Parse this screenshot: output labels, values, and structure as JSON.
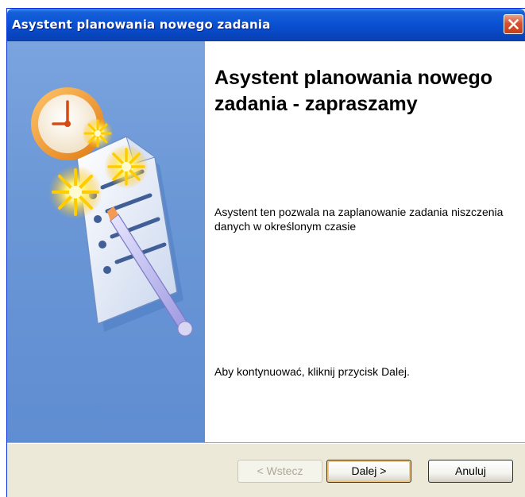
{
  "window": {
    "title": "Asystent planowania nowego zadania"
  },
  "content": {
    "heading": "Asystent planowania nowego zadania - zapraszamy",
    "description": "Asystent ten pozwala na zaplanowanie zadania niszczenia danych w określonym czasie",
    "hint": "Aby kontynuować, kliknij przycisk Dalej."
  },
  "buttons": {
    "back": "< Wstecz",
    "next": "Dalej >",
    "cancel": "Anuluj"
  },
  "icons": {
    "close": "close-icon",
    "wizard": "scheduled-task-wizard-icon"
  },
  "colors": {
    "titlebar": "#0a52d4",
    "banner": "#6b97d6",
    "close_button": "#d8512f",
    "dialog_face": "#ece9d8"
  }
}
